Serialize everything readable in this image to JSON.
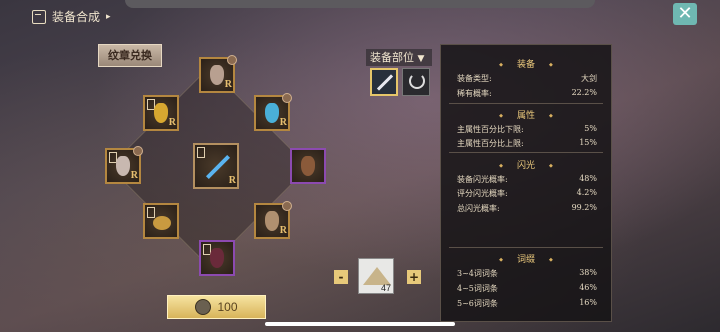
{
  "header": {
    "title": "装备合成"
  },
  "exchange_button": "纹章兑换",
  "equip_part": {
    "label": "装备部位",
    "arrow": "▼"
  },
  "slots_marker": "R",
  "info_panel": {
    "equipment": {
      "title": "装备",
      "rows": [
        {
          "label": "装备类型:",
          "value": "大剑"
        },
        {
          "label": "稀有概率:",
          "value": "22.2%"
        }
      ]
    },
    "attribute": {
      "title": "属性",
      "rows": [
        {
          "label": "主属性百分比下限:",
          "value": "5%"
        },
        {
          "label": "主属性百分比上限:",
          "value": "15%"
        }
      ]
    },
    "flash": {
      "title": "闪光",
      "rows": [
        {
          "label": "装备闪光概率:",
          "value": "48%"
        },
        {
          "label": "评分闪光概率:",
          "value": "4.2%"
        },
        {
          "label": "总闪光概率:",
          "value": "99.2%"
        }
      ]
    },
    "affix": {
      "title": "词缀",
      "rows": [
        {
          "label": "3~4词词条",
          "value": "38%"
        },
        {
          "label": "4~5词词条",
          "value": "46%"
        },
        {
          "label": "5~6词词条",
          "value": "16%"
        }
      ]
    }
  },
  "material": {
    "count": "47",
    "minus": "-",
    "plus": "+"
  },
  "cost": {
    "value": "100"
  },
  "close_icon": "✕"
}
